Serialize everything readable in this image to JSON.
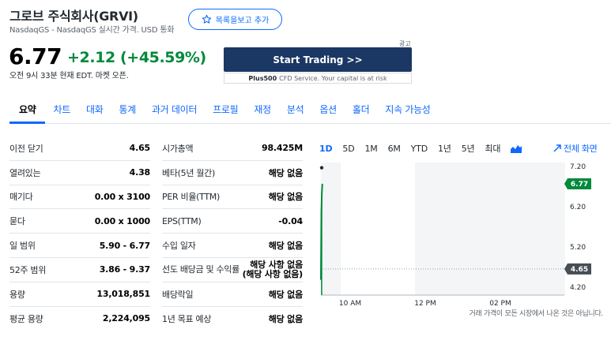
{
  "header": {
    "company_name": "그로브 주식회사(GRVI)",
    "exchange_info": "NasdaqGS - NasdaqGS 실시간 가격. USD 통화",
    "watchlist_button": "목록을보고 추가"
  },
  "quote": {
    "price": "6.77",
    "change": "+2.12 (+45.59%)",
    "market_time": "오전 9시 33분 현재 EDT. 마켓 오픈."
  },
  "ad": {
    "label": "광고",
    "button": "Start Trading >>",
    "caption_brand": "Plus500",
    "caption_rest": "CFD Service. Your capital is at risk"
  },
  "tabs": [
    "요약",
    "차트",
    "대화",
    "통계",
    "과거 데이터",
    "프로필",
    "재정",
    "분석",
    "옵션",
    "홀더",
    "지속 가능성"
  ],
  "stats_left": [
    {
      "label": "이전 닫기",
      "value": "4.65"
    },
    {
      "label": "열려있는",
      "value": "4.38"
    },
    {
      "label": "매기다",
      "value": "0.00 x 3100"
    },
    {
      "label": "묻다",
      "value": "0.00 x 1000"
    },
    {
      "label": "일 범위",
      "value": "5.90 - 6.77"
    },
    {
      "label": "52주 범위",
      "value": "3.86 - 9.37"
    },
    {
      "label": "용량",
      "value": "13,018,851"
    },
    {
      "label": "평균 용량",
      "value": "2,224,095"
    }
  ],
  "stats_right": [
    {
      "label": "시가총액",
      "value": "98.425M"
    },
    {
      "label": "베타(5년 월간)",
      "value": "해당 없음"
    },
    {
      "label": "PER 비율(TTM)",
      "value": "해당 없음"
    },
    {
      "label": "EPS(TTM)",
      "value": "-0.04"
    },
    {
      "label": "수입 일자",
      "value": "해당 없음"
    },
    {
      "label": "선도 배당금 및 수익률",
      "value": "해당 사항 없음 (해당 사항 없음)"
    },
    {
      "label": "배당락일",
      "value": "해당 없음"
    },
    {
      "label": "1년 목표 예상",
      "value": "해당 없음"
    }
  ],
  "chart_controls": {
    "ranges": [
      "1D",
      "5D",
      "1M",
      "6M",
      "YTD",
      "1년",
      "5년",
      "최대"
    ],
    "active_range": "1D",
    "fullscreen_label": "전체 화면"
  },
  "chart_data": {
    "type": "line",
    "x_ticks": [
      "10 AM",
      "12 PM",
      "02 PM"
    ],
    "y_ticks": [
      "7.20",
      "6.20",
      "5.20",
      "4.20"
    ],
    "ylim": [
      4.0,
      7.3
    ],
    "current_price_label": "6.77",
    "previous_close_label": "4.65",
    "previous_close": 4.65,
    "series": [
      {
        "x": [
          "09:30",
          "09:31",
          "09:32",
          "09:33"
        ],
        "values": [
          4.38,
          6.1,
          6.55,
          6.77
        ]
      }
    ],
    "colors": {
      "line": "#008a3c",
      "current_tag": "#008a3c",
      "prev_tag": "#464e56"
    },
    "disclaimer": "거래 가격이 모든 시장에서 나온 것은 아닙니다."
  }
}
